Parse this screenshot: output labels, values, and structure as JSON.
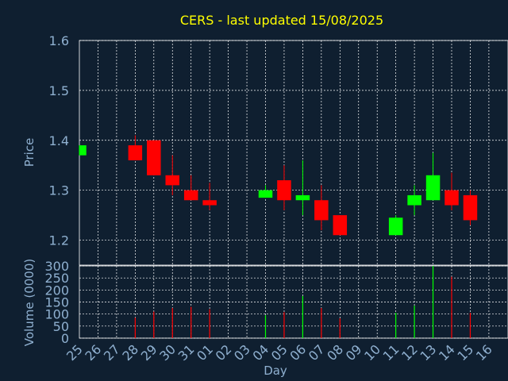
{
  "chart_data": [
    {
      "type": "candlestick",
      "title": "CERS - last updated 15/08/2025",
      "ylabel": "Price",
      "ylim": [
        1.15,
        1.6
      ],
      "yticks": [
        "1.2",
        "1.3",
        "1.4",
        "1.5",
        "1.6"
      ],
      "grid": true,
      "colors": {
        "up": "#00ff00",
        "down": "#ff0000",
        "title": "#ffff00",
        "label": "#8fb0d0",
        "grid": "#ffffff"
      },
      "candles": [
        {
          "day": "25",
          "open": 1.37,
          "high": 1.39,
          "low": 1.37,
          "close": 1.39
        },
        {
          "day": "28",
          "open": 1.39,
          "high": 1.41,
          "low": 1.36,
          "close": 1.36
        },
        {
          "day": "29",
          "open": 1.4,
          "high": 1.4,
          "low": 1.33,
          "close": 1.33
        },
        {
          "day": "30",
          "open": 1.33,
          "high": 1.37,
          "low": 1.29,
          "close": 1.31
        },
        {
          "day": "31",
          "open": 1.3,
          "high": 1.33,
          "low": 1.28,
          "close": 1.28
        },
        {
          "day": "01",
          "open": 1.28,
          "high": 1.315,
          "low": 1.26,
          "close": 1.27
        },
        {
          "day": "04",
          "open": 1.285,
          "high": 1.31,
          "low": 1.285,
          "close": 1.3
        },
        {
          "day": "05",
          "open": 1.32,
          "high": 1.35,
          "low": 1.26,
          "close": 1.28
        },
        {
          "day": "06",
          "open": 1.28,
          "high": 1.36,
          "low": 1.25,
          "close": 1.29
        },
        {
          "day": "07",
          "open": 1.28,
          "high": 1.31,
          "low": 1.22,
          "close": 1.24
        },
        {
          "day": "08",
          "open": 1.25,
          "high": 1.25,
          "low": 1.21,
          "close": 1.21
        },
        {
          "day": "11",
          "open": 1.21,
          "high": 1.25,
          "low": 1.21,
          "close": 1.245
        },
        {
          "day": "12",
          "open": 1.27,
          "high": 1.31,
          "low": 1.25,
          "close": 1.29
        },
        {
          "day": "13",
          "open": 1.28,
          "high": 1.375,
          "low": 1.28,
          "close": 1.33
        },
        {
          "day": "14",
          "open": 1.3,
          "high": 1.335,
          "low": 1.26,
          "close": 1.27
        },
        {
          "day": "15",
          "open": 1.29,
          "high": 1.3,
          "low": 1.23,
          "close": 1.24
        }
      ]
    },
    {
      "type": "bar",
      "ylabel": "Volume (0000)",
      "xlabel": "Day",
      "ylim": [
        0,
        300
      ],
      "yticks": [
        "0",
        "50",
        "100",
        "150",
        "200",
        "250",
        "300"
      ],
      "categories": [
        "25",
        "26",
        "27",
        "28",
        "29",
        "30",
        "31",
        "01",
        "02",
        "03",
        "04",
        "05",
        "06",
        "07",
        "08",
        "09",
        "10",
        "11",
        "12",
        "13",
        "14",
        "15",
        "16"
      ],
      "values": [
        0,
        0,
        0,
        85,
        110,
        125,
        130,
        120,
        0,
        0,
        95,
        108,
        175,
        125,
        82,
        0,
        0,
        105,
        135,
        300,
        255,
        105,
        0
      ],
      "direction": [
        "",
        "",
        "",
        "down",
        "down",
        "down",
        "down",
        "down",
        "",
        "",
        "up",
        "down",
        "up",
        "down",
        "down",
        "",
        "",
        "up",
        "up",
        "up",
        "down",
        "down",
        ""
      ]
    }
  ]
}
